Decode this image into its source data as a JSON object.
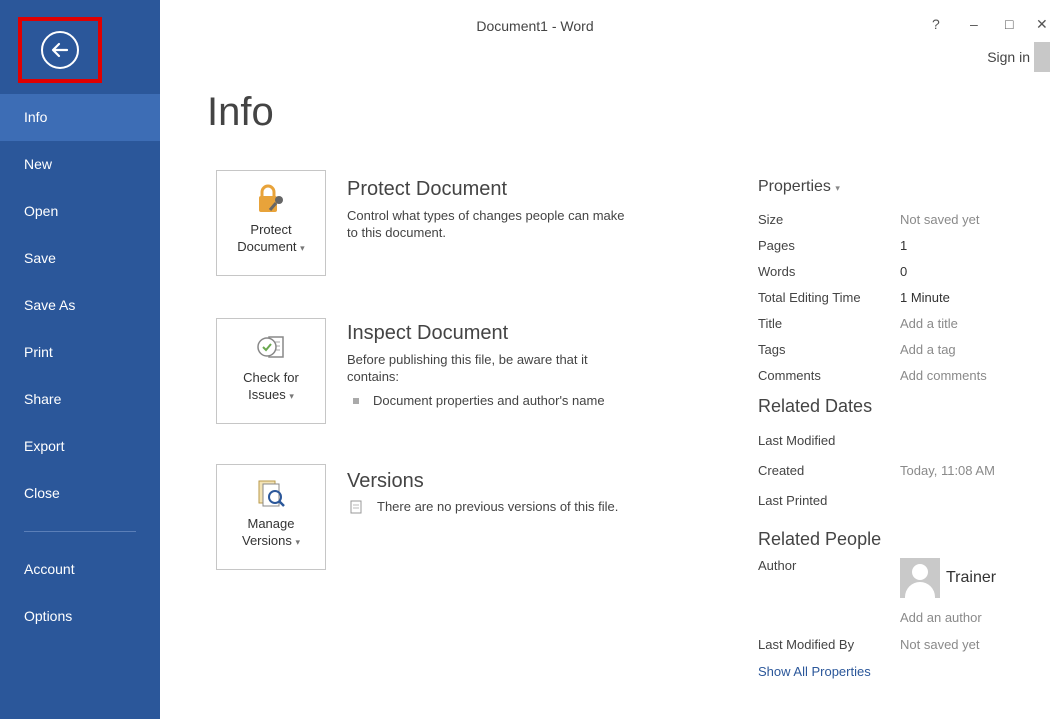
{
  "window": {
    "title": "Document1 - Word",
    "help": "?",
    "minimize": "–",
    "maximize": "□",
    "close": "✕",
    "sign_in": "Sign in"
  },
  "sidebar": {
    "back_label": "Back",
    "items": [
      {
        "label": "Info",
        "active": true
      },
      {
        "label": "New"
      },
      {
        "label": "Open"
      },
      {
        "label": "Save"
      },
      {
        "label": "Save As"
      },
      {
        "label": "Print"
      },
      {
        "label": "Share"
      },
      {
        "label": "Export"
      },
      {
        "label": "Close"
      }
    ],
    "bottom_items": [
      {
        "label": "Account"
      },
      {
        "label": "Options"
      }
    ],
    "accent": "#2b579a"
  },
  "page": {
    "title": "Info"
  },
  "sections": {
    "protect": {
      "tile_line1": "Protect",
      "tile_line2": "Document",
      "heading": "Protect Document",
      "desc_line1": "Control what types of changes people can make",
      "desc_line2": "to this document."
    },
    "inspect": {
      "tile_line1": "Check for",
      "tile_line2": "Issues",
      "heading": "Inspect Document",
      "desc_line1": "Before publishing this file, be aware that it",
      "desc_line2": "contains:",
      "bullet": "Document properties and author's name"
    },
    "versions": {
      "tile_line1": "Manage",
      "tile_line2": "Versions",
      "heading": "Versions",
      "desc": "There are no previous versions of this file."
    }
  },
  "properties": {
    "heading": "Properties",
    "rows": [
      {
        "key": "Size",
        "value": "Not saved yet"
      },
      {
        "key": "Pages",
        "value": "1"
      },
      {
        "key": "Words",
        "value": "0"
      },
      {
        "key": "Total Editing Time",
        "value": "1 Minute"
      },
      {
        "key": "Title",
        "value": "Add a title"
      },
      {
        "key": "Tags",
        "value": "Add a tag"
      },
      {
        "key": "Comments",
        "value": "Add comments"
      }
    ],
    "dates_heading": "Related Dates",
    "dates": [
      {
        "key": "Last Modified",
        "value": ""
      },
      {
        "key": "Created",
        "value": "Today, 11:08 AM"
      },
      {
        "key": "Last Printed",
        "value": ""
      }
    ],
    "people_heading": "Related People",
    "author_key": "Author",
    "author_name": "Trainer",
    "add_author": "Add an author",
    "last_modified_by_key": "Last Modified By",
    "last_modified_by_value": "Not saved yet",
    "show_all": "Show All Properties"
  }
}
